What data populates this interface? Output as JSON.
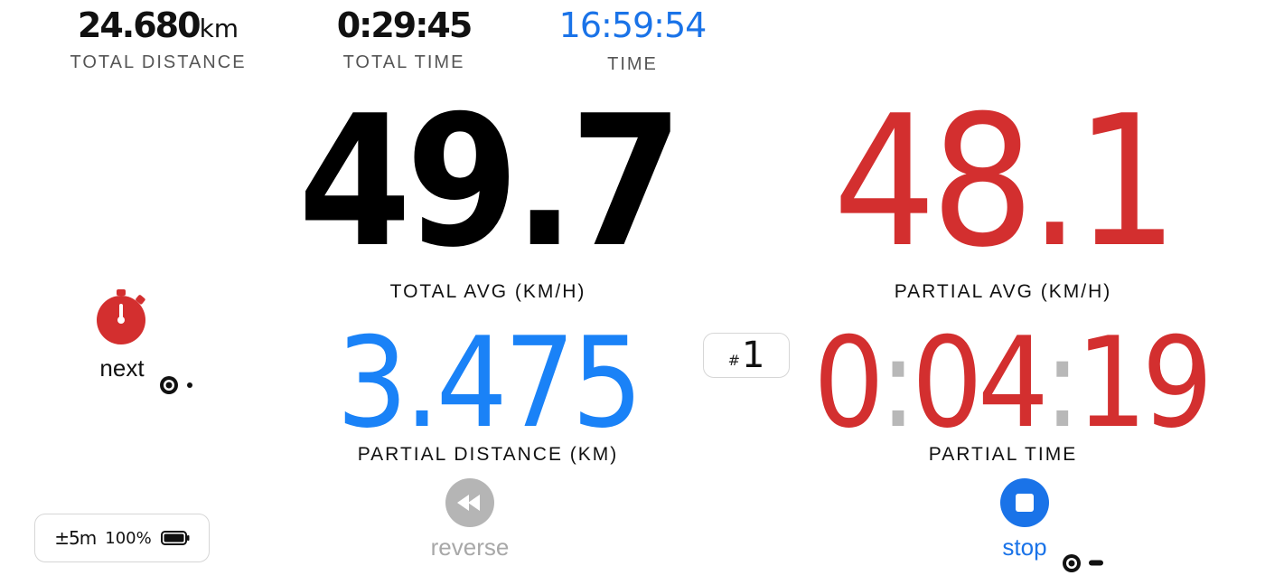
{
  "top": {
    "total_distance": {
      "value": "24.680",
      "unit": "km",
      "label": "TOTAL DISTANCE"
    },
    "total_time": {
      "value": "0:29:45",
      "label": "TOTAL TIME"
    },
    "clock": {
      "value": "16:59:54",
      "label": "TIME"
    }
  },
  "main": {
    "total_avg": {
      "value": "49.7",
      "label": "TOTAL AVG (KM/H)"
    },
    "partial_avg": {
      "value": "48.1",
      "label": "PARTIAL AVG (KM/H)"
    },
    "partial_distance": {
      "value": "3.475",
      "label": "PARTIAL DISTANCE (KM)"
    },
    "partial_time": {
      "h": "0",
      "m": "04",
      "s": "19",
      "separator": ":",
      "label": "PARTIAL TIME"
    },
    "lap": {
      "hash": "#",
      "number": "1"
    }
  },
  "controls": {
    "next": {
      "label": "next",
      "icon": "stopwatch-icon",
      "color": "#d32f2f"
    },
    "reverse": {
      "label": "reverse",
      "icon": "rewind-icon",
      "color": "#b5b5b5"
    },
    "stop": {
      "label": "stop",
      "icon": "stop-icon",
      "color": "#1a73e8"
    }
  },
  "status": {
    "gps_accuracy": "±5m",
    "battery": "100%",
    "battery_icon": "battery-full-icon"
  },
  "colors": {
    "accent_red": "#d32f2f",
    "accent_blue": "#1a73e8",
    "partial_distance_blue": "#1a82f7"
  }
}
